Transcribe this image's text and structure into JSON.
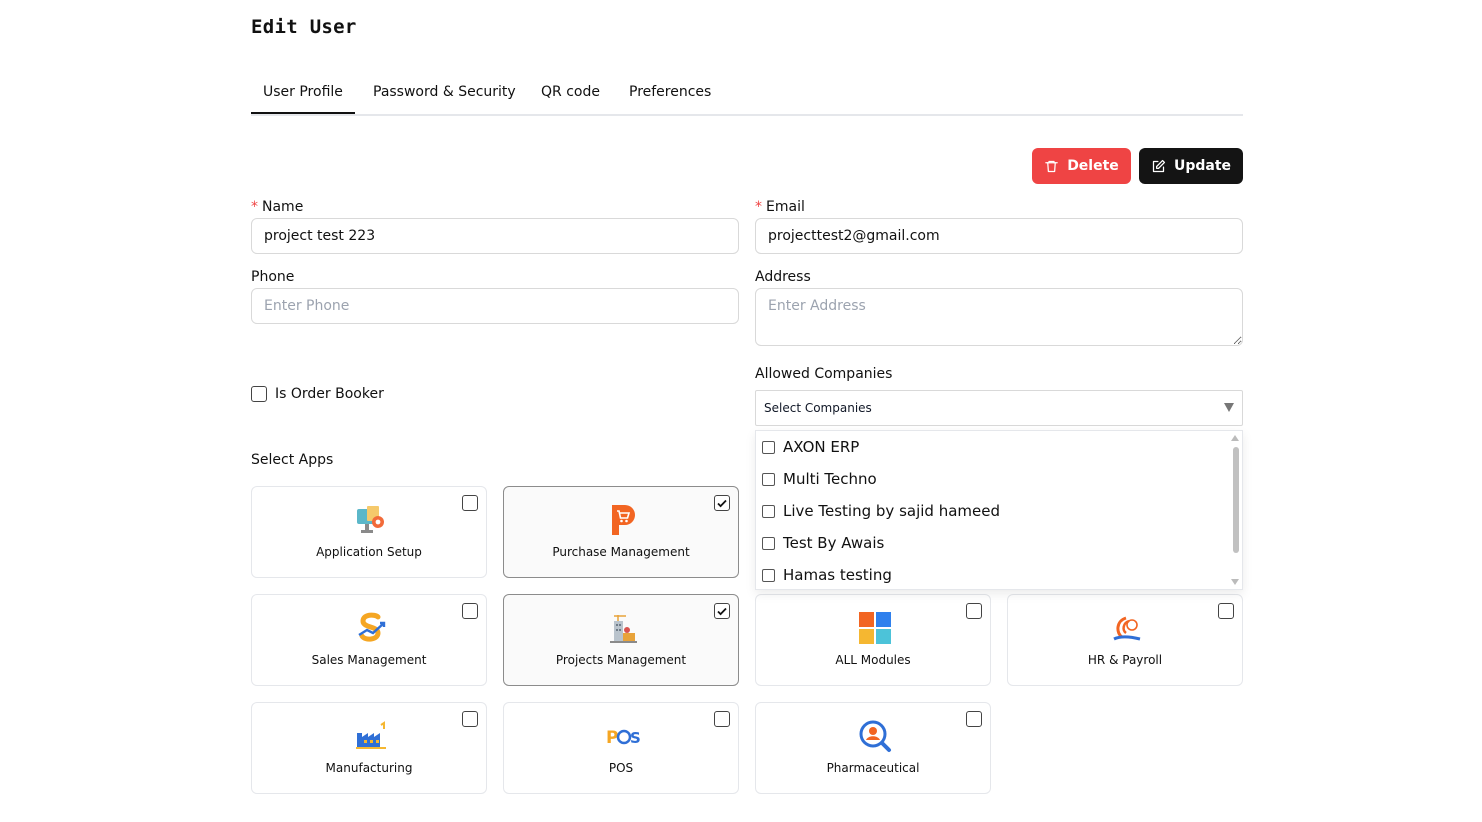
{
  "page": {
    "title": "Edit User"
  },
  "tabs": [
    {
      "label": "User Profile",
      "active": true
    },
    {
      "label": "Password & Security",
      "active": false
    },
    {
      "label": "QR code",
      "active": false
    },
    {
      "label": "Preferences",
      "active": false
    }
  ],
  "actions": {
    "delete_label": "Delete",
    "update_label": "Update"
  },
  "form": {
    "required_mark": "*",
    "name": {
      "label": "Name",
      "value": "project test 223"
    },
    "email": {
      "label": "Email",
      "value": "projecttest2@gmail.com"
    },
    "phone": {
      "label": "Phone",
      "placeholder": "Enter Phone"
    },
    "address": {
      "label": "Address",
      "placeholder": "Enter Address"
    },
    "order_booker": {
      "label": "Is Order Booker",
      "checked": false
    },
    "allowed_companies": {
      "label": "Allowed Companies",
      "placeholder": "Select Companies",
      "options": [
        "AXON ERP",
        "Multi Techno",
        "Live Testing by sajid hameed",
        "Test By Awais",
        "Hamas testing"
      ]
    }
  },
  "apps": {
    "label": "Select Apps",
    "items": [
      {
        "name": "Application Setup",
        "icon": "application-setup-icon",
        "checked": false
      },
      {
        "name": "Purchase Management",
        "icon": "purchase-management-icon",
        "checked": true
      },
      {
        "name": "Sales Management",
        "icon": "sales-management-icon",
        "checked": false
      },
      {
        "name": "Projects Management",
        "icon": "projects-management-icon",
        "checked": true
      },
      {
        "name": "ALL Modules",
        "icon": "all-modules-icon",
        "checked": false
      },
      {
        "name": "HR & Payroll",
        "icon": "hr-payroll-icon",
        "checked": false
      },
      {
        "name": "Manufacturing",
        "icon": "manufacturing-icon",
        "checked": false
      },
      {
        "name": "POS",
        "icon": "pos-icon",
        "checked": false
      },
      {
        "name": "Pharmaceutical",
        "icon": "pharmaceutical-icon",
        "checked": false
      }
    ]
  },
  "colors": {
    "delete": "#ef4444",
    "update": "#141414",
    "required": "#ef4444"
  }
}
